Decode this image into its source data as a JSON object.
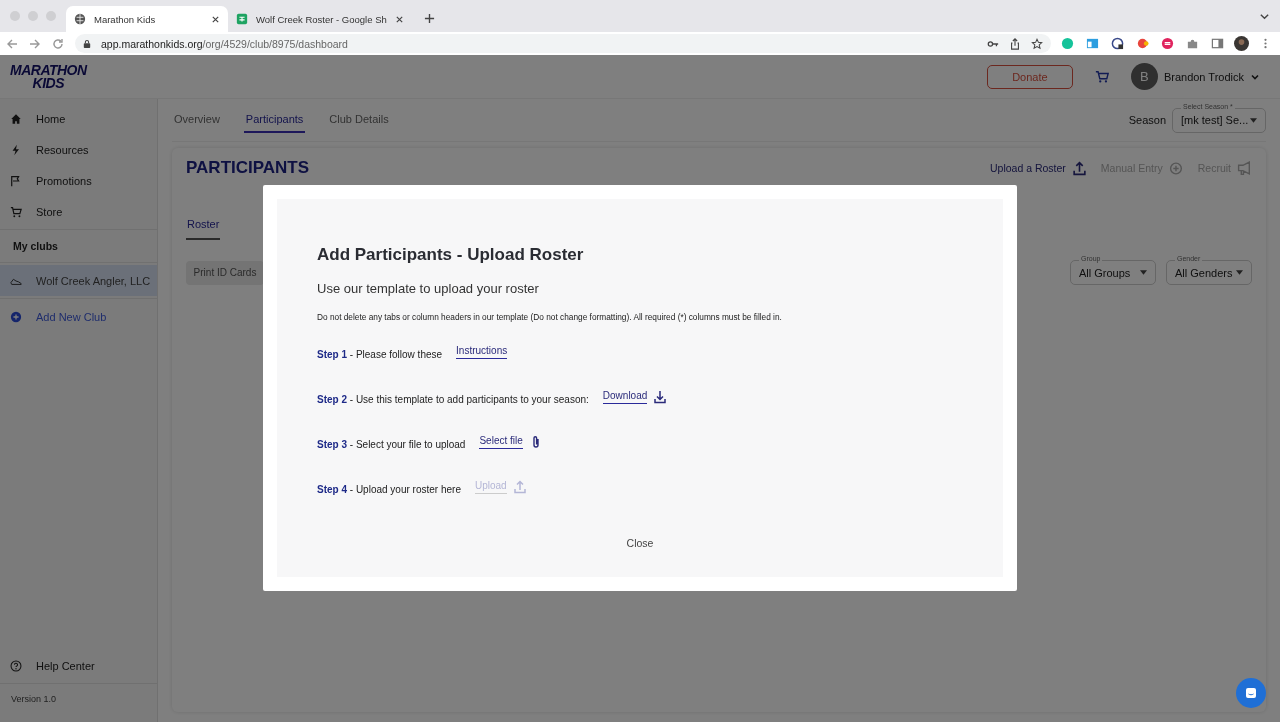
{
  "browser": {
    "tabs": [
      {
        "title": "Marathon Kids",
        "selected": true
      },
      {
        "title": "Wolf Creek Roster - Google Sh",
        "selected": false
      }
    ],
    "url_host": "app.marathonkids.org",
    "url_path": "/org/4529/club/8975/dashboard"
  },
  "header": {
    "logo_line_1": "MARATHON",
    "logo_line_2": "KIDS",
    "donate": "Donate",
    "avatar_initial": "B",
    "user_name": "Brandon Trodick"
  },
  "sidebar": {
    "items": [
      {
        "label": "Home"
      },
      {
        "label": "Resources"
      },
      {
        "label": "Promotions"
      },
      {
        "label": "Store"
      }
    ],
    "clubs_heading": "My clubs",
    "clubs": [
      {
        "label": "Wolf Creek Angler, LLC",
        "selected": true
      }
    ],
    "add_club": "Add New Club",
    "help": "Help Center",
    "version": "Version 1.0"
  },
  "tabs": [
    {
      "label": "Overview",
      "selected": false
    },
    {
      "label": "Participants",
      "selected": true
    },
    {
      "label": "Club Details",
      "selected": false
    }
  ],
  "season": {
    "label": "Season",
    "field_label": "Select Season *",
    "value": "[mk test] Se..."
  },
  "participants": {
    "title": "PARTICIPANTS",
    "actions": [
      {
        "label": "Upload a Roster",
        "disabled": false
      },
      {
        "label": "Manual Entry",
        "disabled": true
      },
      {
        "label": "Recruit",
        "disabled": true
      }
    ],
    "subtabs": [
      {
        "label": "Roster",
        "selected": true
      }
    ],
    "print_button": "Print ID Cards",
    "filters": [
      {
        "label": "Group",
        "value": "All Groups"
      },
      {
        "label": "Gender",
        "value": "All Genders"
      }
    ]
  },
  "modal": {
    "title": "Add Participants - Upload Roster",
    "subtitle": "Use our template to upload your roster",
    "note": "Do not delete any tabs or column headers in our template (Do not change formatting). All required (*) columns must be filled in.",
    "steps": [
      {
        "step": "Step 1",
        "text": " - Please follow these",
        "action": "Instructions",
        "disabled": false
      },
      {
        "step": "Step 2",
        "text": " - Use this template to add participants to your season:",
        "action": "Download",
        "disabled": false
      },
      {
        "step": "Step 3",
        "text": " - Select your file to upload",
        "action": "Select file",
        "disabled": false
      },
      {
        "step": "Step 4",
        "text": " - Upload your roster here",
        "action": "Upload",
        "disabled": true
      }
    ],
    "close": "Close"
  }
}
